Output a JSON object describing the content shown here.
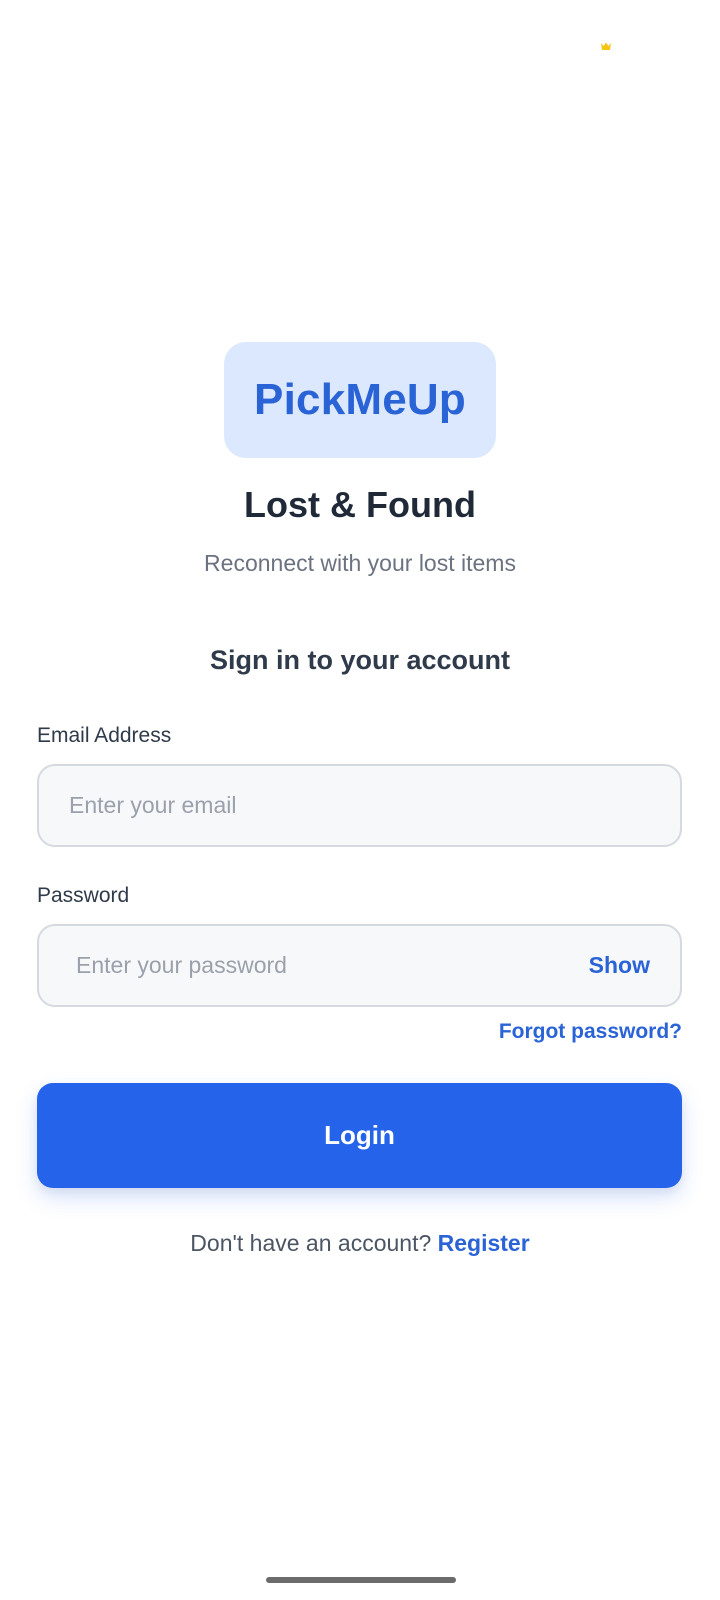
{
  "brand": {
    "logo_text": "PickMeUp",
    "accent_color": "#2563eb",
    "logo_bg_color": "#dbe8fe"
  },
  "header": {
    "title": "Lost & Found",
    "subtitle": "Reconnect with your lost items"
  },
  "form": {
    "heading": "Sign in to your account",
    "email": {
      "label": "Email Address",
      "placeholder": "Enter your email",
      "value": ""
    },
    "password": {
      "label": "Password",
      "placeholder": "Enter your password",
      "value": "",
      "show_label": "Show"
    },
    "forgot_label": "Forgot password?",
    "login_label": "Login"
  },
  "footer": {
    "prompt": "Don't have an account?",
    "register_label": "Register"
  },
  "status_bar": {
    "icon": "crown-icon"
  }
}
